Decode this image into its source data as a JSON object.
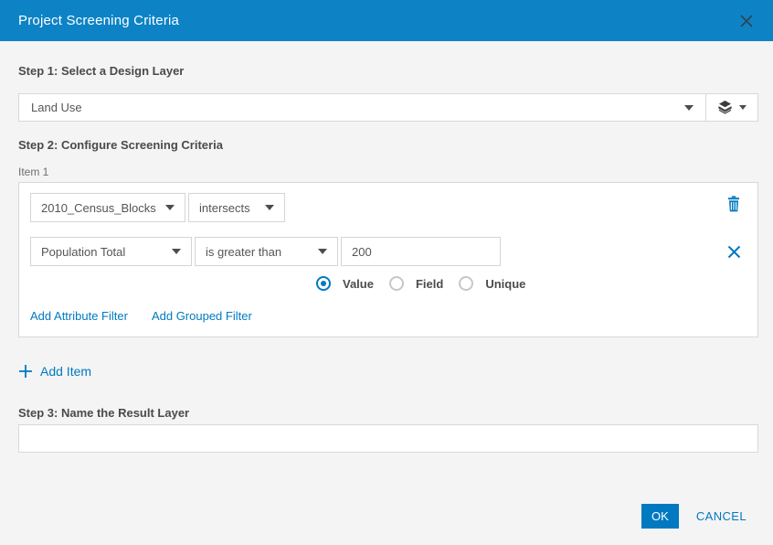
{
  "dialog": {
    "title": "Project Screening Criteria"
  },
  "step1": {
    "label": "Step 1: Select a Design Layer",
    "design_layer_value": "Land Use"
  },
  "step2": {
    "label": "Step 2: Configure Screening Criteria",
    "item_label": "Item 1",
    "screening_layer_value": "2010_Census_Blocks",
    "spatial_operator_value": "intersects",
    "attribute_filter": {
      "field_value": "Population Total",
      "condition_value": "is greater than",
      "value": "200",
      "radios": [
        {
          "label": "Value",
          "selected": true
        },
        {
          "label": "Field",
          "selected": false
        },
        {
          "label": "Unique",
          "selected": false
        }
      ]
    },
    "links": {
      "add_attribute_filter": "Add Attribute Filter",
      "add_grouped_filter": "Add Grouped Filter"
    },
    "add_item_label": "Add Item"
  },
  "step3": {
    "label": "Step 3: Name the Result Layer",
    "result_layer_value": "",
    "result_layer_placeholder": ""
  },
  "footer": {
    "ok_label": "OK",
    "cancel_label": "CANCEL"
  },
  "colors": {
    "header_bg": "#0d83c6",
    "accent": "#0079c1",
    "body_bg": "#f4f4f4"
  },
  "icons": {
    "close": "close-icon",
    "layers": "layers-icon",
    "trash": "trash-icon",
    "remove": "remove-x-icon",
    "plus": "plus-icon",
    "dropdown_caret": "chevron-down-icon"
  }
}
